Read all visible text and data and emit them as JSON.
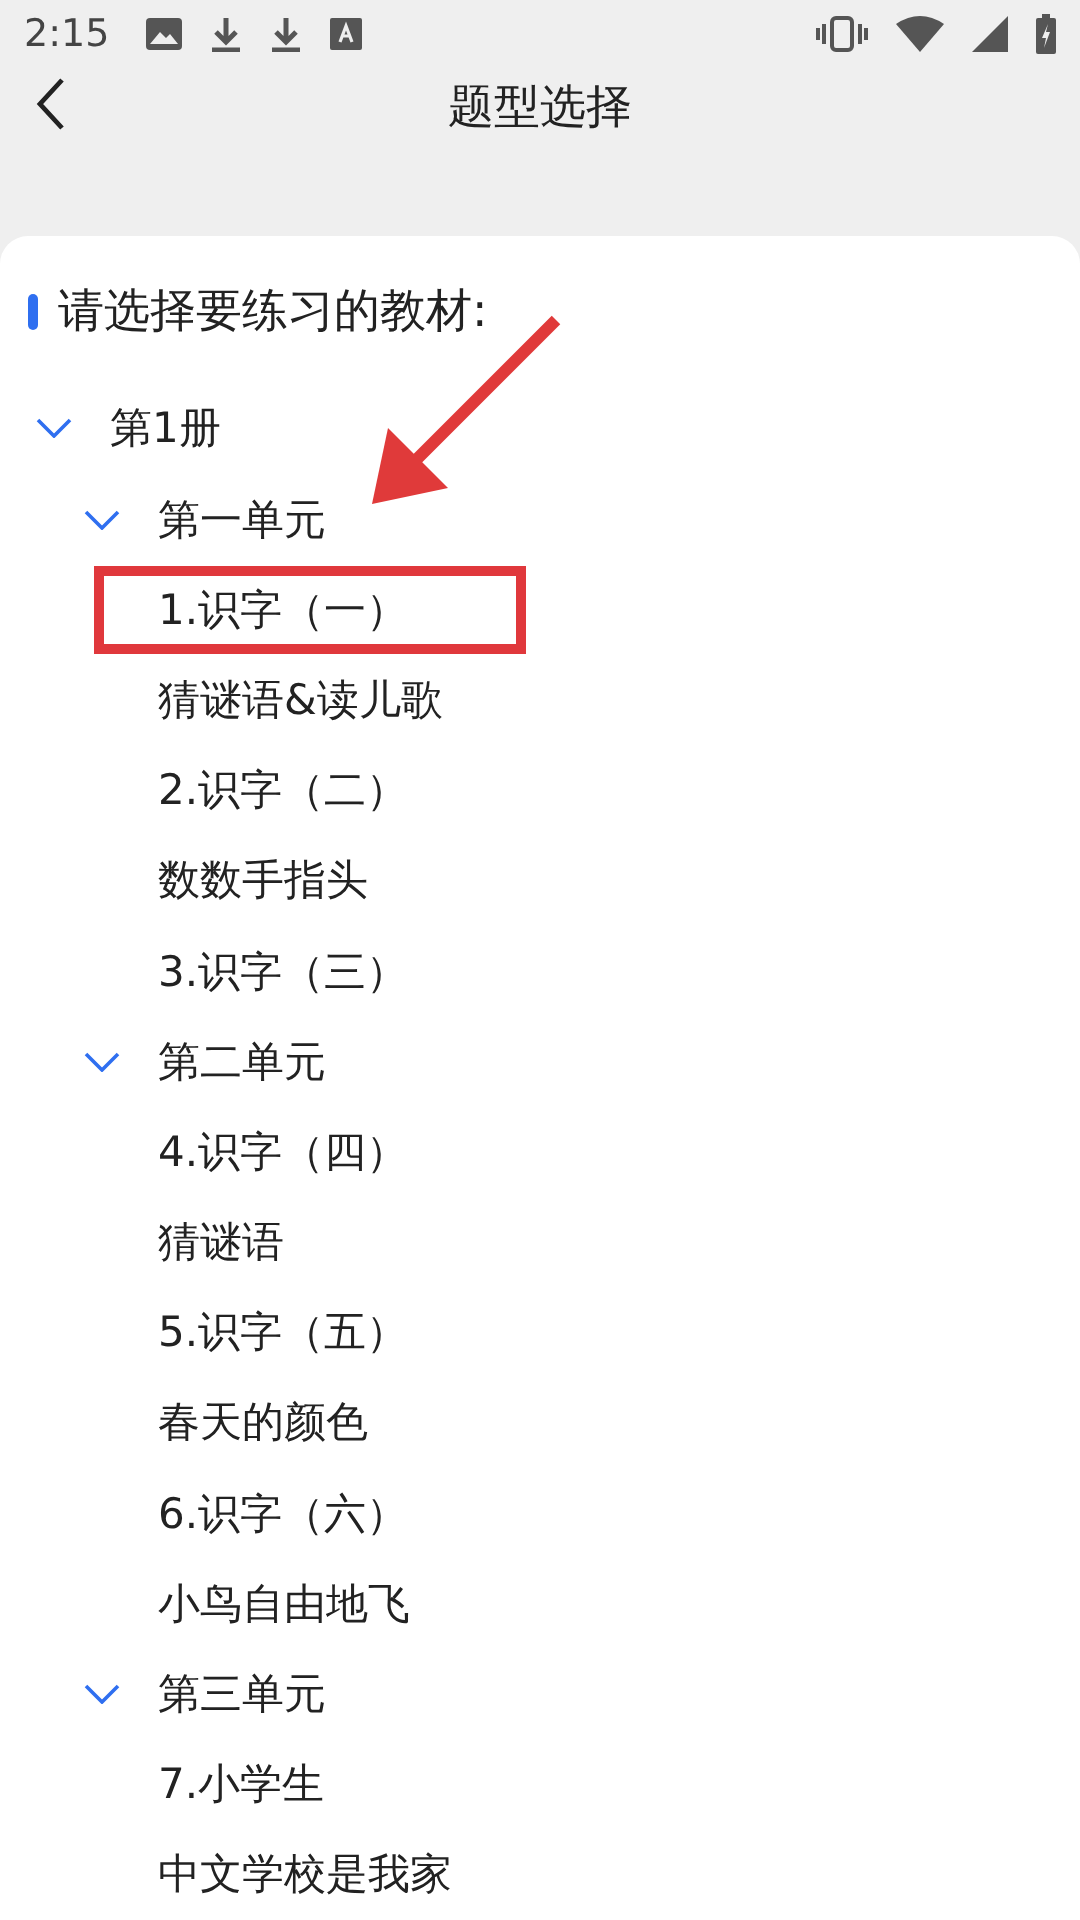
{
  "status_bar": {
    "time": "2:15"
  },
  "header": {
    "title": "题型选择"
  },
  "heading": "请选择要练习的教材:",
  "tree": [
    {
      "label": "第1册",
      "expanded": true,
      "children": [
        {
          "label": "第一单元",
          "expanded": true,
          "children": [
            {
              "label": "1.识字（一）",
              "highlighted": true
            },
            {
              "label": "猜谜语&读儿歌",
              "highlighted": false
            },
            {
              "label": "2.识字（二）",
              "highlighted": false
            },
            {
              "label": "数数手指头",
              "highlighted": false
            },
            {
              "label": "3.识字（三）",
              "highlighted": false
            }
          ]
        },
        {
          "label": "第二单元",
          "expanded": true,
          "children": [
            {
              "label": "4.识字（四）",
              "highlighted": false
            },
            {
              "label": "猜谜语",
              "highlighted": false
            },
            {
              "label": "5.识字（五）",
              "highlighted": false
            },
            {
              "label": "春天的颜色",
              "highlighted": false
            },
            {
              "label": "6.识字（六）",
              "highlighted": false
            },
            {
              "label": "小鸟自由地飞",
              "highlighted": false
            }
          ]
        },
        {
          "label": "第三单元",
          "expanded": true,
          "children": [
            {
              "label": "7.小学生",
              "highlighted": false
            },
            {
              "label": "中文学校是我家",
              "highlighted": false
            }
          ]
        }
      ]
    }
  ]
}
